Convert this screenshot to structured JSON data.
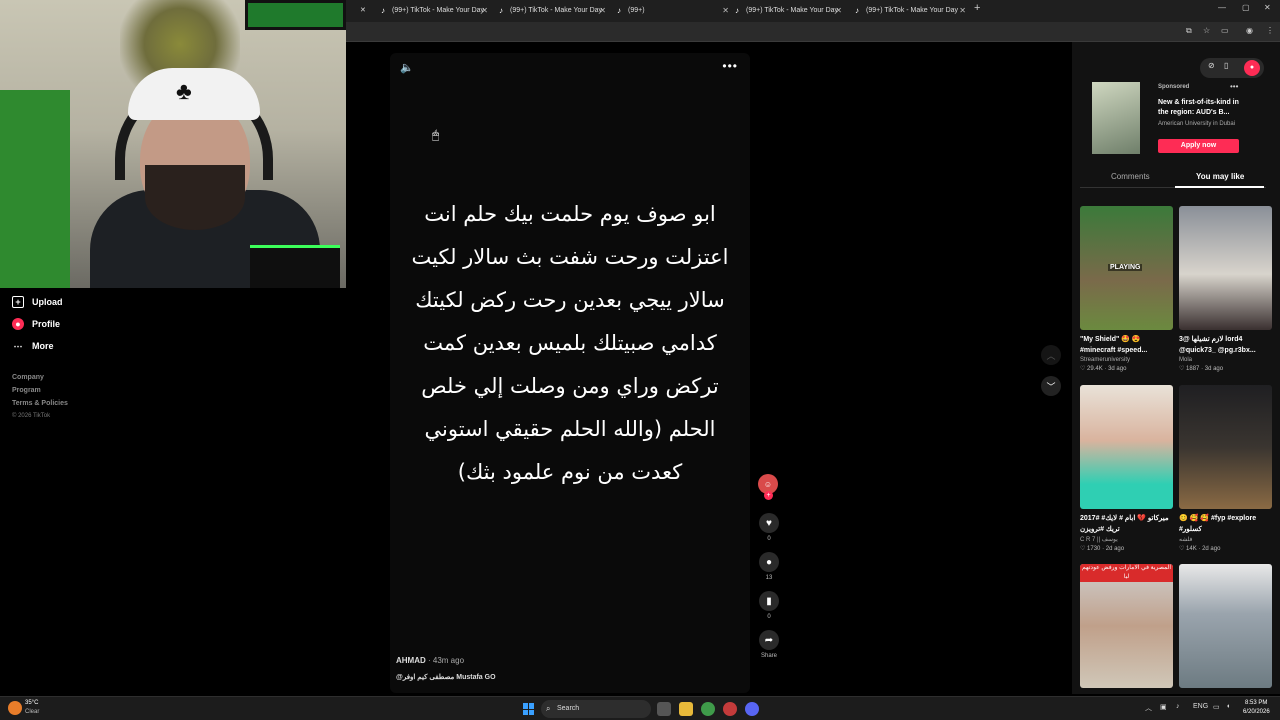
{
  "browser": {
    "tabs": [
      {
        "label": "(99+) TikTok - Make Your Day"
      },
      {
        "label": "(99+) TikTok - Make Your Day"
      },
      {
        "label": "(99+)"
      },
      {
        "label": "(99+) TikTok - Make Your Day"
      },
      {
        "label": "(99+) TikTok - Make Your Day"
      }
    ],
    "new_tab": "+"
  },
  "sidebar": {
    "items": [
      {
        "label": "Upload",
        "icon": "upload-icon"
      },
      {
        "label": "Profile",
        "icon": "profile-icon"
      },
      {
        "label": "More",
        "icon": "more-icon"
      }
    ],
    "footer": [
      "Company",
      "Program",
      "Terms & Policies"
    ],
    "copyright": "© 2026 TikTok"
  },
  "video": {
    "caption_lines": [
      "ابو صوف يوم حلمت بيك حلم انت",
      "اعتزلت ورحت شفت بث سالار لكيت",
      "سالار ييجي بعدين رحت ركض لكيتك",
      "كدامي صبيتلك بلميس بعدين كمت",
      "تركض وراي ومن وصلت إلي خلص",
      "الحلم (والله الحلم حقيقي استوني",
      "كعدت من نوم علمود بثك)"
    ],
    "author": "AHMAD",
    "time": " · 43m ago",
    "description": "@مصطفى كيم اوفر Mustafa GO"
  },
  "actions": {
    "likes": "0",
    "comments": "13",
    "saves": "0",
    "share_label": "Share"
  },
  "ad": {
    "sponsored": "Sponsored",
    "title": "New & first-of-its-kind in the region: AUD's B...",
    "advertiser": "American University in Dubai",
    "cta": "Apply now"
  },
  "panel_tabs": {
    "comments": "Comments",
    "you_may_like": "You may like"
  },
  "cards": [
    {
      "title": "\"My Shield\" 🤩 😍 #minecraft #speed...",
      "author": "Streameruniversity",
      "likes": "♡ 29.4K",
      "age": "3d ago",
      "overlay": "PLAYING"
    },
    {
      "title": "3@ لازم تشيلها lord4 @quick73_ @pg.r3bx...",
      "author": "Mola",
      "likes": "♡ 1887",
      "age": "3d ago"
    },
    {
      "title": "2017# #ميركاتو 💔 ابام # لايك تريك #ترويزن",
      "author": "C R 7 || يوسف",
      "likes": "♡ 1730",
      "age": "2d ago"
    },
    {
      "title": "😊 🥰 🥰 #fyp #explore #كسلور",
      "author": "فلشه",
      "likes": "♡ 14K",
      "age": "2d ago"
    },
    {
      "title": "",
      "author": "",
      "likes": "",
      "age": "",
      "overlay": "المصرية في الامارات ورفض عودتهم ليا"
    },
    {
      "title": "",
      "author": "",
      "likes": "",
      "age": ""
    }
  ],
  "taskbar": {
    "weather_temp": "35°C",
    "weather_cond": "Clear",
    "search": "Search",
    "lang": "ENG",
    "time": "8:53 PM",
    "date": "6/20/2026"
  },
  "colors": {
    "accent": "#fe2c55",
    "background": "#000000",
    "panel": "#121212"
  }
}
